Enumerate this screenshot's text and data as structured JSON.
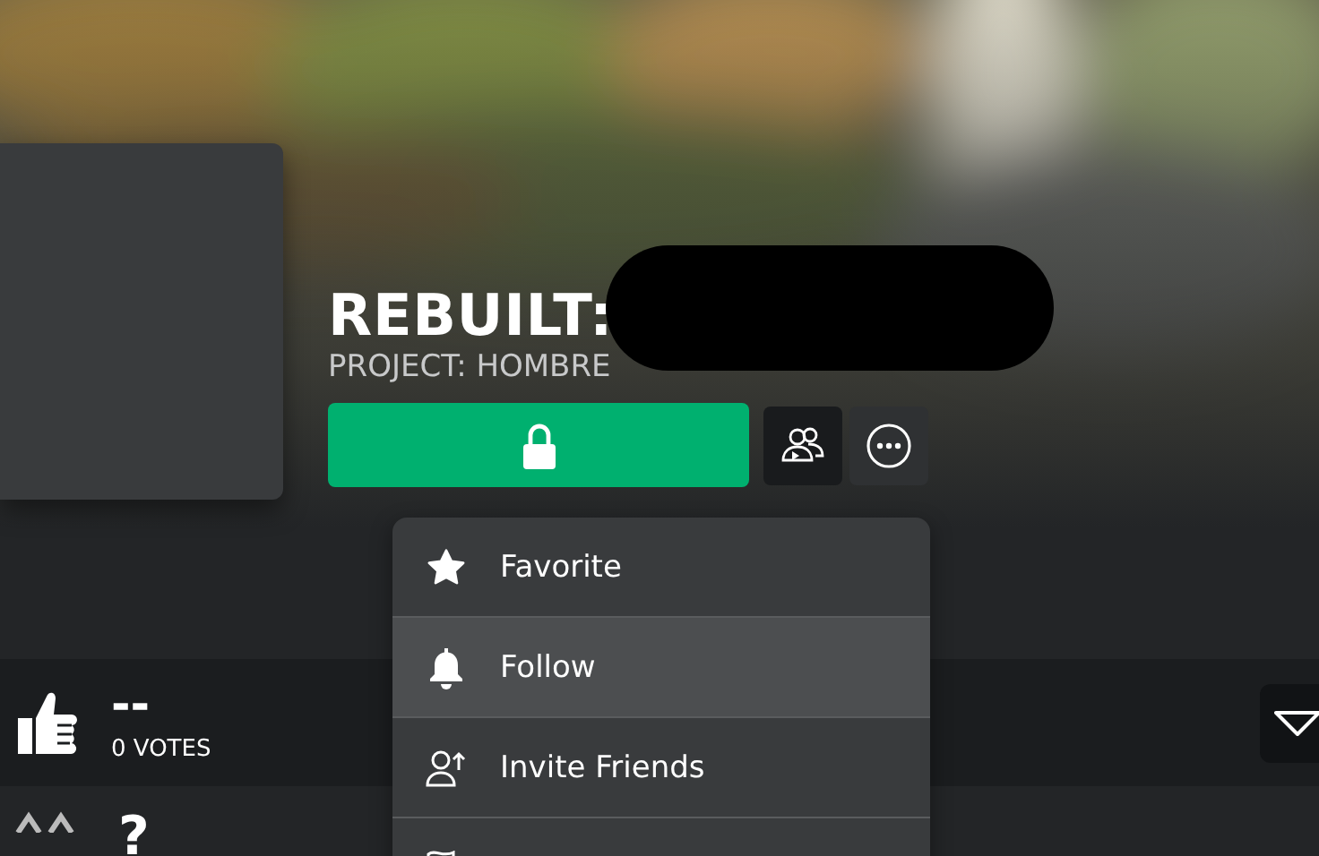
{
  "game": {
    "title": "REBUILT:",
    "subtitle": "PROJECT: HOMBRE",
    "play_locked": true
  },
  "menu": [
    {
      "label": "Favorite",
      "selected": false
    },
    {
      "label": "Follow",
      "selected": true
    },
    {
      "label": "Invite Friends",
      "selected": false
    },
    {
      "selected": false
    }
  ],
  "votes": {
    "rating": "--",
    "count": "0 VOTES"
  },
  "next_stat": {
    "value": "?"
  }
}
